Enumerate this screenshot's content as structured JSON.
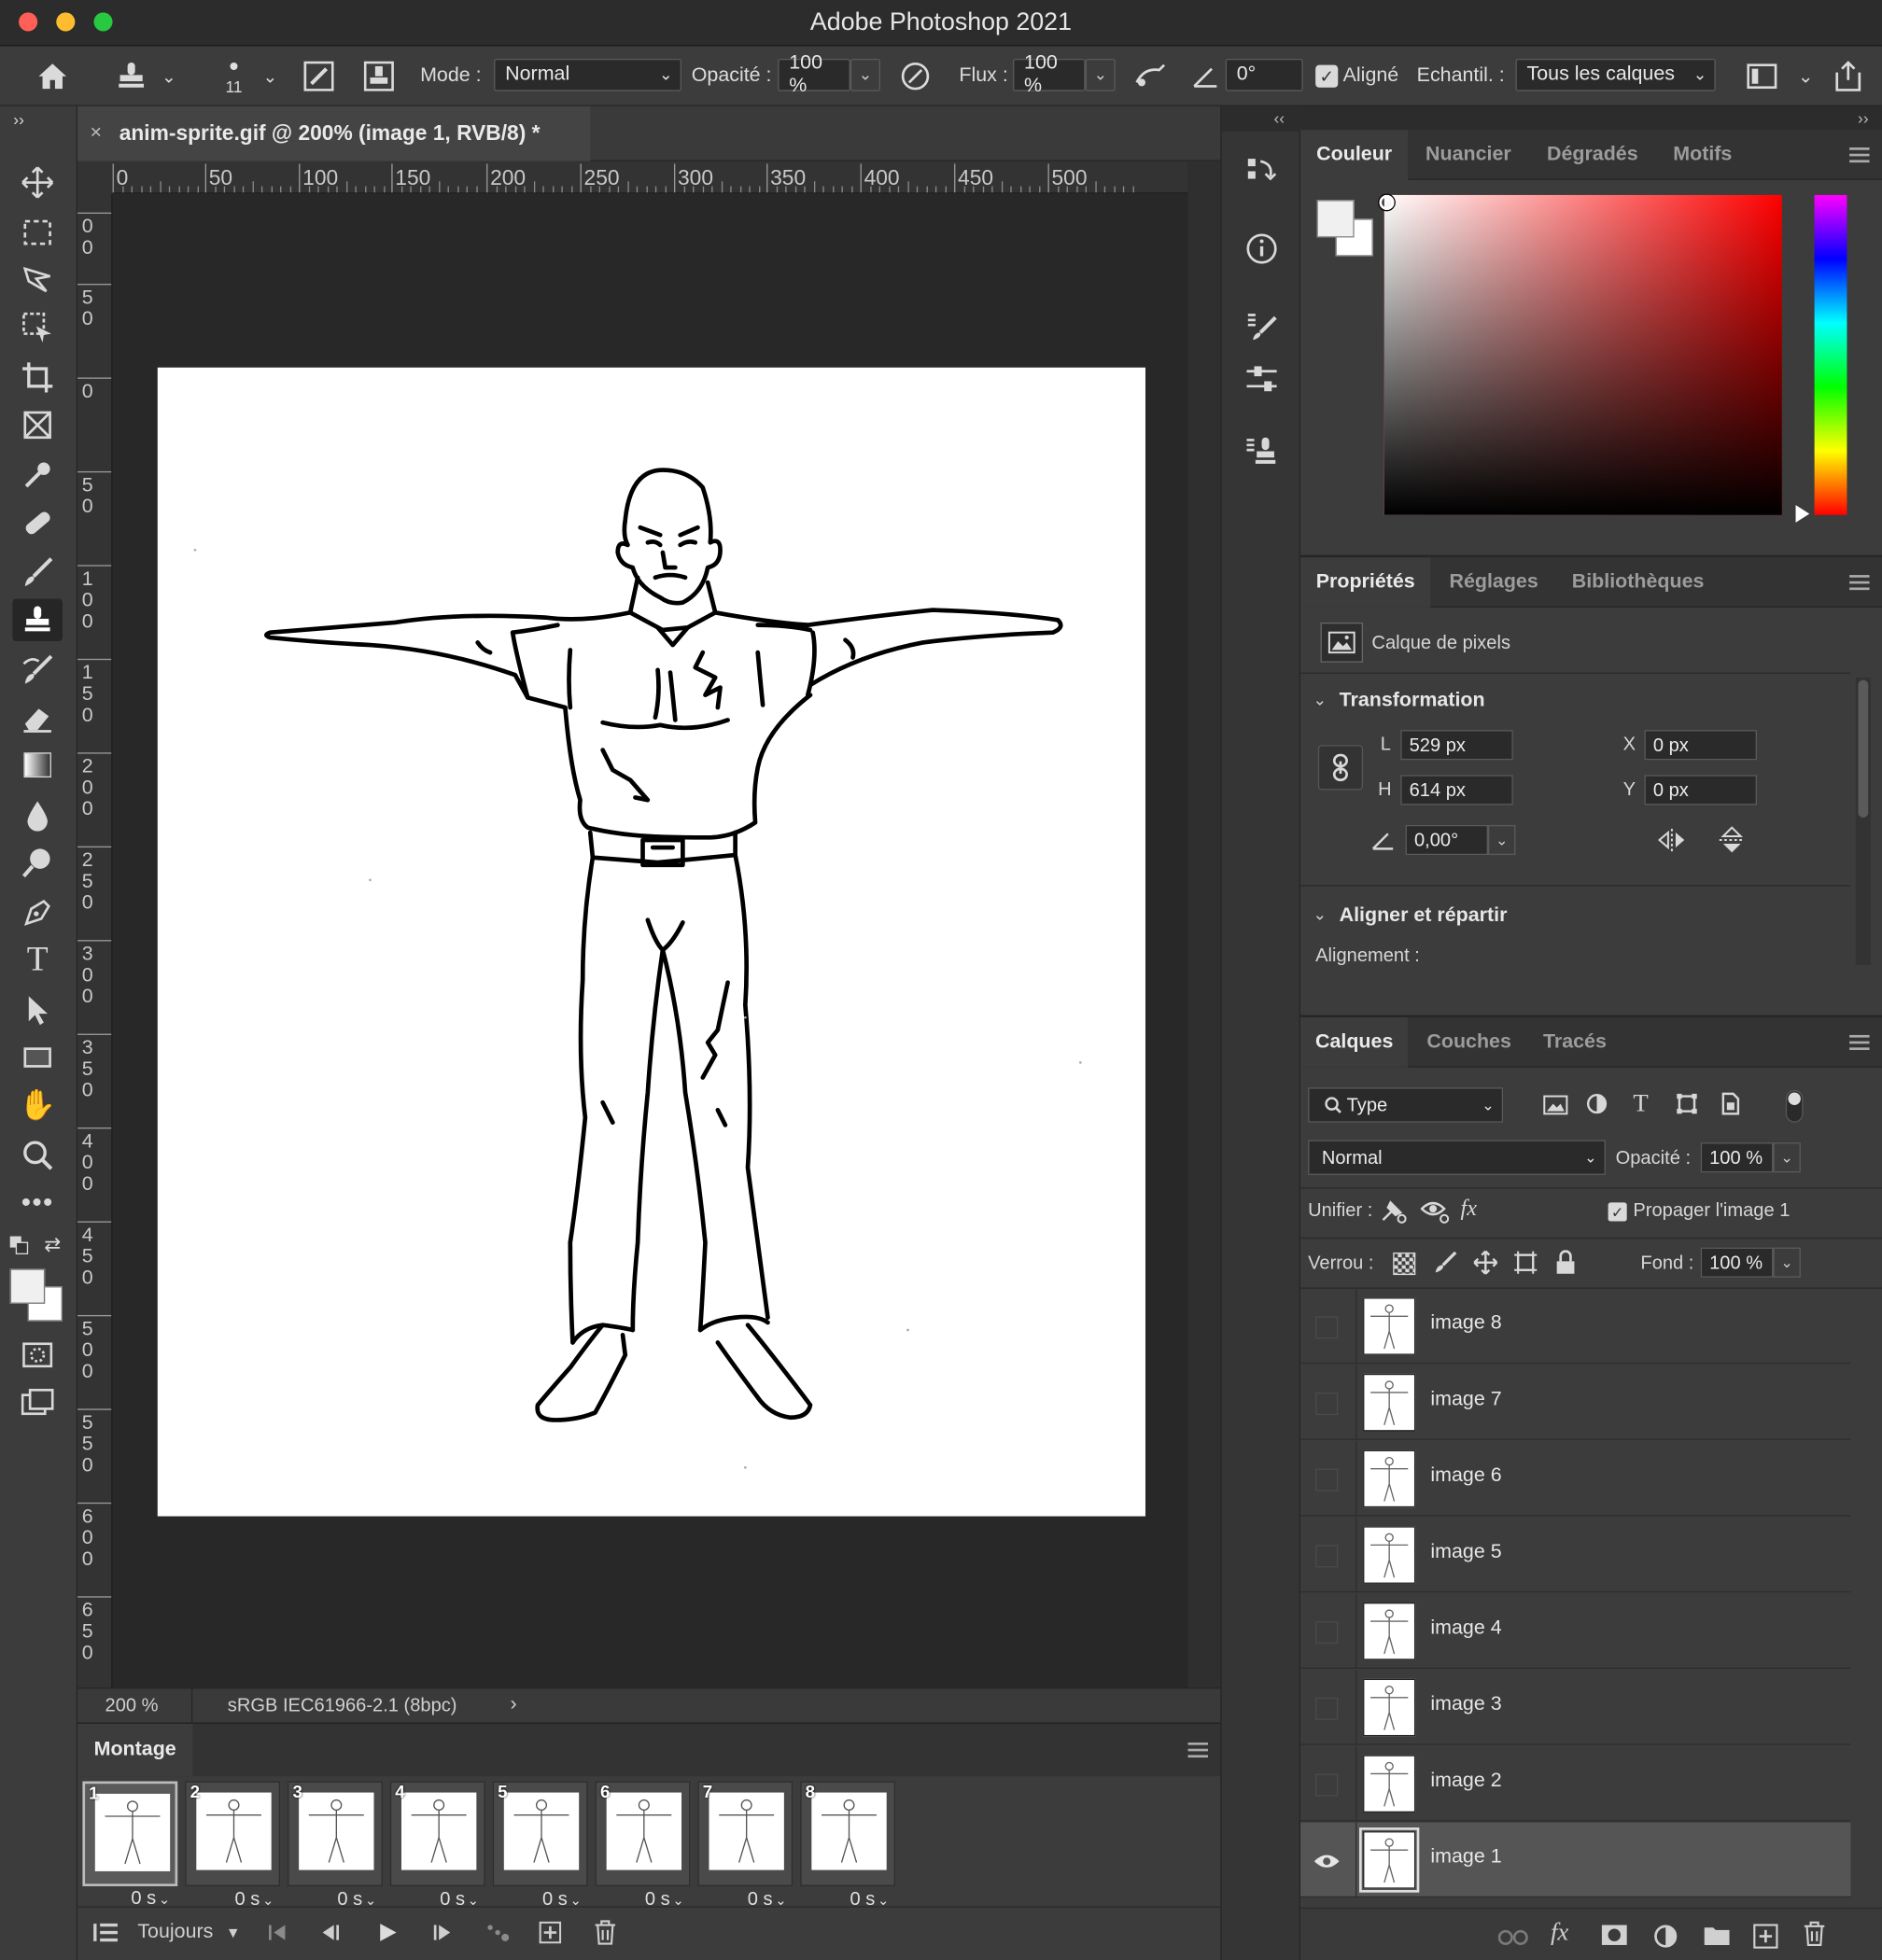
{
  "window": {
    "title": "Adobe Photoshop 2021"
  },
  "options": {
    "brush_size": "11",
    "mode_label": "Mode :",
    "mode_value": "Normal",
    "opacity_label": "Opacité :",
    "opacity_value": "100 %",
    "flow_label": "Flux :",
    "flow_value": "100 %",
    "angle_value": "0°",
    "aligned_label": "Aligné",
    "sample_label": "Echantil. :",
    "sample_value": "Tous les calques"
  },
  "document": {
    "tab_title": "anim-sprite.gif @ 200% (image 1, RVB/8) *",
    "ruler_h": [
      "0",
      "50",
      "100",
      "150",
      "200",
      "250",
      "300",
      "350",
      "400",
      "450",
      "500"
    ],
    "ruler_v": [
      "00",
      "50",
      "0",
      "50",
      "100",
      "150",
      "200",
      "250",
      "300",
      "350",
      "400",
      "450",
      "500",
      "550",
      "600",
      "650"
    ],
    "zoom": "200 %",
    "color_profile": "sRGB IEC61966-2.1 (8bpc)"
  },
  "montage": {
    "title": "Montage",
    "frames": [
      {
        "num": "1",
        "delay": "0 s"
      },
      {
        "num": "2",
        "delay": "0 s"
      },
      {
        "num": "3",
        "delay": "0 s"
      },
      {
        "num": "4",
        "delay": "0 s"
      },
      {
        "num": "5",
        "delay": "0 s"
      },
      {
        "num": "6",
        "delay": "0 s"
      },
      {
        "num": "7",
        "delay": "0 s"
      },
      {
        "num": "8",
        "delay": "0 s"
      }
    ],
    "loop": "Toujours"
  },
  "color_panel": {
    "tabs": [
      "Couleur",
      "Nuancier",
      "Dégradés",
      "Motifs"
    ],
    "foreground": "#f0f0f0",
    "background": "#ffffff",
    "hue": "#ff0000"
  },
  "properties_panel": {
    "tabs": [
      "Propriétés",
      "Réglages",
      "Bibliothèques"
    ],
    "kind": "Calque de pixels",
    "transform_title": "Transformation",
    "w_label": "L",
    "w_value": "529 px",
    "h_label": "H",
    "h_value": "614 px",
    "x_label": "X",
    "x_value": "0 px",
    "y_label": "Y",
    "y_value": "0 px",
    "angle_value": "0,00°",
    "align_title": "Aligner et répartir",
    "align_label": "Alignement :"
  },
  "layers_panel": {
    "tabs": [
      "Calques",
      "Couches",
      "Tracés"
    ],
    "filter": "Type",
    "blend": "Normal",
    "opacity_label": "Opacité :",
    "opacity_value": "100 %",
    "unify_label": "Unifier :",
    "propagate_label": "Propager l'image 1",
    "lock_label": "Verrou :",
    "fill_label": "Fond :",
    "fill_value": "100 %",
    "layers": [
      "image 8",
      "image 7",
      "image 6",
      "image 5",
      "image 4",
      "image 3",
      "image 2",
      "image 1"
    ]
  }
}
